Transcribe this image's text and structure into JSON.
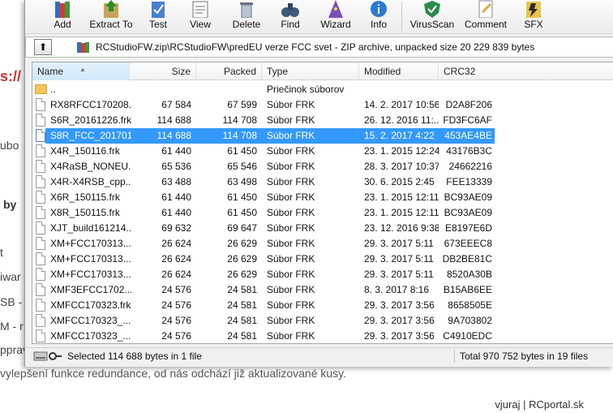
{
  "background_page": {
    "fragments": [
      "s://",
      "ubo",
      "by",
      "t",
      "iwar",
      "SB -",
      "M - r",
      "pprav"
    ],
    "footer_line": "vylepšení funkce redundance, od nás odchází již aktualizované kusy.",
    "credit": "vjuraj | RCportal.sk"
  },
  "toolbar": {
    "buttons": [
      {
        "label": "Add",
        "icon": "add-books-icon"
      },
      {
        "label": "Extract To",
        "icon": "extract-icon"
      },
      {
        "label": "Test",
        "icon": "test-icon"
      },
      {
        "label": "View",
        "icon": "view-icon"
      },
      {
        "label": "Delete",
        "icon": "delete-icon"
      },
      {
        "label": "Find",
        "icon": "binoculars-icon"
      },
      {
        "label": "Wizard",
        "icon": "wizard-icon"
      },
      {
        "label": "Info",
        "icon": "info-icon"
      },
      {
        "label": "VirusScan",
        "icon": "virusscan-icon"
      },
      {
        "label": "Comment",
        "icon": "comment-icon"
      },
      {
        "label": "SFX",
        "icon": "sfx-icon"
      }
    ]
  },
  "address_bar": {
    "up_label": "⬆",
    "path": "RCStudioFW.zip\\RCStudioFW\\predEU verze FCC svet - ZIP archive, unpacked size 20 229 839 bytes"
  },
  "columns": {
    "name": "Name",
    "size": "Size",
    "packed": "Packed",
    "type": "Type",
    "modified": "Modified",
    "crc": "CRC32"
  },
  "rows": [
    {
      "name": "..",
      "size": "",
      "packed": "",
      "type": "Priečinok súborov",
      "modified": "",
      "crc": "",
      "icon": "folder",
      "selected": false
    },
    {
      "name": "RX8RFCC170208...",
      "size": "67 584",
      "packed": "67 599",
      "type": "Súbor FRK",
      "modified": "14. 2. 2017 10:56",
      "crc": "D2A8F206",
      "icon": "file",
      "selected": false
    },
    {
      "name": "S6R_20161226.frk",
      "size": "114 688",
      "packed": "114 708",
      "type": "Súbor FRK",
      "modified": "26. 12. 2016 11:...",
      "crc": "FD3FC6AF",
      "icon": "file",
      "selected": false
    },
    {
      "name": "S8R_FCC_201701...",
      "size": "114 688",
      "packed": "114 708",
      "type": "Súbor FRK",
      "modified": "15. 2. 2017 4:22",
      "crc": "453AE4BE",
      "icon": "file",
      "selected": true
    },
    {
      "name": "X4R_150116.frk",
      "size": "61 440",
      "packed": "61 450",
      "type": "Súbor FRK",
      "modified": "23. 1. 2015 12:24",
      "crc": "43176B3C",
      "icon": "file",
      "selected": false
    },
    {
      "name": "X4RaSB_NONEU...",
      "size": "65 536",
      "packed": "65 546",
      "type": "Súbor FRK",
      "modified": "28. 3. 2017 10:37",
      "crc": "24662216",
      "icon": "file",
      "selected": false
    },
    {
      "name": "X4R-X4RSB_cpp...",
      "size": "63 488",
      "packed": "63 498",
      "type": "Súbor FRK",
      "modified": "30. 6. 2015 2:45",
      "crc": "FEE13339",
      "icon": "file",
      "selected": false
    },
    {
      "name": "X6R_150115.frk",
      "size": "61 440",
      "packed": "61 450",
      "type": "Súbor FRK",
      "modified": "23. 1. 2015 12:11",
      "crc": "BC93AE09",
      "icon": "file",
      "selected": false
    },
    {
      "name": "X8R_150115.frk",
      "size": "61 440",
      "packed": "61 450",
      "type": "Súbor FRK",
      "modified": "23. 1. 2015 12:11",
      "crc": "BC93AE09",
      "icon": "file",
      "selected": false
    },
    {
      "name": "XJT_build161214...",
      "size": "69 632",
      "packed": "69 647",
      "type": "Súbor FRK",
      "modified": "23. 12. 2016 9:38",
      "crc": "E8197E6D",
      "icon": "file",
      "selected": false
    },
    {
      "name": "XM+FCC170313....",
      "size": "26 624",
      "packed": "26 629",
      "type": "Súbor FRK",
      "modified": "29. 3. 2017 5:11",
      "crc": "673EEEC8",
      "icon": "file",
      "selected": false
    },
    {
      "name": "XM+FCC170313....",
      "size": "26 624",
      "packed": "26 629",
      "type": "Súbor FRK",
      "modified": "29. 3. 2017 5:11",
      "crc": "DB2BE81C",
      "icon": "file",
      "selected": false
    },
    {
      "name": "XM+FCC170313....",
      "size": "26 624",
      "packed": "26 629",
      "type": "Súbor FRK",
      "modified": "29. 3. 2017 5:11",
      "crc": "8520A30B",
      "icon": "file",
      "selected": false
    },
    {
      "name": "XMF3EFCC1702...",
      "size": "24 576",
      "packed": "24 581",
      "type": "Súbor FRK",
      "modified": "8. 3. 2017 8:16",
      "crc": "B15AB6EE",
      "icon": "file",
      "selected": false
    },
    {
      "name": "XMFCC170323.frk",
      "size": "24 576",
      "packed": "24 581",
      "type": "Súbor FRK",
      "modified": "29. 3. 2017 3:56",
      "crc": "8658505E",
      "icon": "file",
      "selected": false
    },
    {
      "name": "XMFCC170323_...",
      "size": "24 576",
      "packed": "24 581",
      "type": "Súbor FRK",
      "modified": "29. 3. 2017 3:56",
      "crc": "9A703802",
      "icon": "file",
      "selected": false
    },
    {
      "name": "XMFCC170323_...",
      "size": "24 576",
      "packed": "24 581",
      "type": "Súbor FRK",
      "modified": "29. 3. 2017 3:56",
      "crc": "C4910EDC",
      "icon": "file",
      "selected": false
    }
  ],
  "status": {
    "left": "Selected 114 688 bytes in 1 file",
    "right": "Total 970 752 bytes in 19 files"
  },
  "colors": {
    "selection": "#3399ff",
    "background_link": "#d2322d"
  }
}
